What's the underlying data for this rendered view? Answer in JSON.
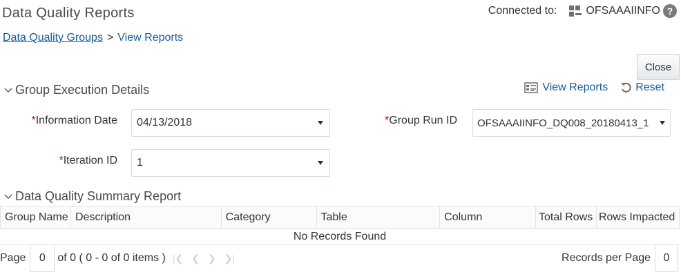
{
  "header": {
    "title": "Data Quality Reports",
    "connected_label": "Connected to:",
    "server_name": "OFSAAAIINFO",
    "help_glyph": "?"
  },
  "breadcrumb": {
    "link": "Data Quality Groups",
    "separator": ">",
    "current": "View Reports"
  },
  "actions": {
    "close_label": "Close"
  },
  "group_execution": {
    "title": "Group Execution Details",
    "view_reports_label": "View Reports",
    "reset_label": "Reset",
    "info_date_label": "Information Date",
    "info_date_value": "04/13/2018",
    "group_run_label": "Group Run ID",
    "group_run_value": "OFSAAAIINFO_DQ008_20180413_1",
    "iteration_label": "Iteration ID",
    "iteration_value": "1",
    "required_marker": "*"
  },
  "summary": {
    "title": "Data Quality Summary Report",
    "columns": [
      "Group Name",
      "Description",
      "Category",
      "Table",
      "Column",
      "Total Rows",
      "Rows Impacted"
    ],
    "empty_message": "No Records Found"
  },
  "pagination": {
    "page_label": "Page",
    "page_value": "0",
    "summary": "of 0 ( 0 - 0 of 0 items )",
    "records_per_page_label": "Records per Page",
    "records_per_page_value": "0"
  },
  "colors": {
    "link": "#145c9e",
    "required": "#c4001a",
    "title": "#4a4a4a"
  },
  "icons": [
    "grid-icon",
    "help-icon",
    "chevron-down-icon",
    "view-reports-icon",
    "reset-icon",
    "first-page-icon",
    "prev-page-icon",
    "next-page-icon",
    "last-page-icon"
  ]
}
